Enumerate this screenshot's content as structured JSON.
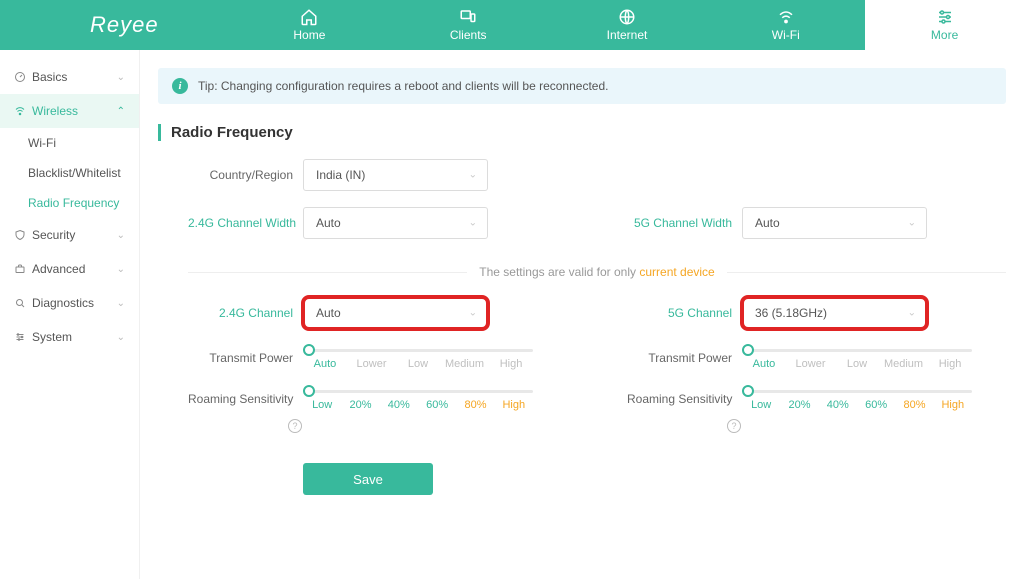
{
  "header": {
    "brand": "Reyee",
    "tabs": [
      {
        "id": "home",
        "label": "Home"
      },
      {
        "id": "clients",
        "label": "Clients"
      },
      {
        "id": "internet",
        "label": "Internet"
      },
      {
        "id": "wifi",
        "label": "Wi-Fi"
      },
      {
        "id": "more",
        "label": "More",
        "active": true
      }
    ]
  },
  "sidebar": {
    "groups": [
      {
        "id": "basics",
        "label": "Basics",
        "expanded": false
      },
      {
        "id": "wireless",
        "label": "Wireless",
        "expanded": true,
        "items": [
          {
            "id": "wifi",
            "label": "Wi-Fi",
            "active": false
          },
          {
            "id": "blacklist",
            "label": "Blacklist/Whitelist",
            "active": false
          },
          {
            "id": "radio",
            "label": "Radio Frequency",
            "active": true
          }
        ]
      },
      {
        "id": "security",
        "label": "Security",
        "expanded": false
      },
      {
        "id": "advanced",
        "label": "Advanced",
        "expanded": false
      },
      {
        "id": "diagnostics",
        "label": "Diagnostics",
        "expanded": false
      },
      {
        "id": "system",
        "label": "System",
        "expanded": false
      }
    ]
  },
  "tip": {
    "icon": "i",
    "text": "Tip: Changing configuration requires a reboot and clients will be reconnected."
  },
  "page": {
    "title": "Radio Frequency"
  },
  "form": {
    "country_label": "Country/Region",
    "country_value": "India (IN)",
    "width24_label": "2.4G Channel Width",
    "width24_value": "Auto",
    "width5_label": "5G Channel Width",
    "width5_value": "Auto",
    "divider_text_plain": "The settings are valid for only ",
    "divider_text_accent": "current device",
    "chan24_label": "2.4G Channel",
    "chan24_value": "Auto",
    "chan5_label": "5G Channel",
    "chan5_value": "36  (5.18GHz)",
    "tx_label": "Transmit Power",
    "tx_ticks": [
      "Auto",
      "Lower",
      "Low",
      "Medium",
      "High"
    ],
    "tx_position_pct": 0,
    "roam_label": "Roaming Sensitivity",
    "roam_ticks": [
      "Low",
      "20%",
      "40%",
      "60%",
      "80%",
      "High"
    ],
    "roam_position_pct": 0,
    "save_label": "Save",
    "help_glyph": "?"
  }
}
